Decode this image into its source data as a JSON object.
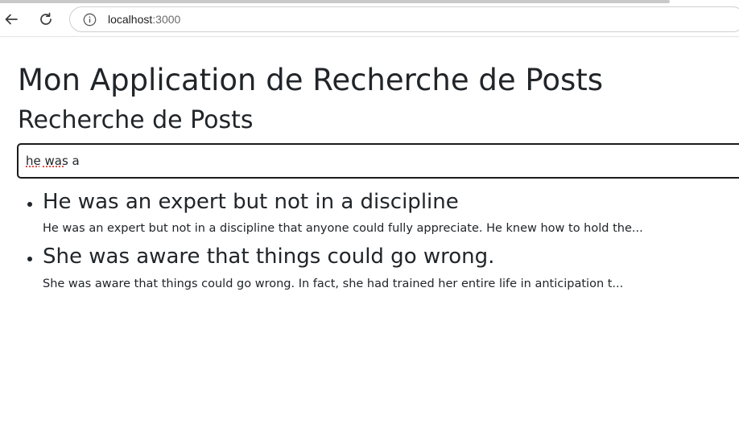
{
  "browser": {
    "url_host": "localhost",
    "url_port": ":3000"
  },
  "page": {
    "app_title": "Mon Application de Recherche de Posts",
    "section_title": "Recherche de Posts",
    "search": {
      "value": "he was a"
    },
    "results": [
      {
        "title": "He was an expert but not in a discipline",
        "excerpt": "He was an expert but not in a discipline that anyone could fully appreciate. He knew how to hold the..."
      },
      {
        "title": "She was aware that things could go wrong.",
        "excerpt": "She was aware that things could go wrong. In fact, she had trained her entire life in anticipation t..."
      }
    ]
  },
  "icons": {
    "back": "arrow-left-icon",
    "reload": "reload-icon",
    "info": "info-icon"
  }
}
